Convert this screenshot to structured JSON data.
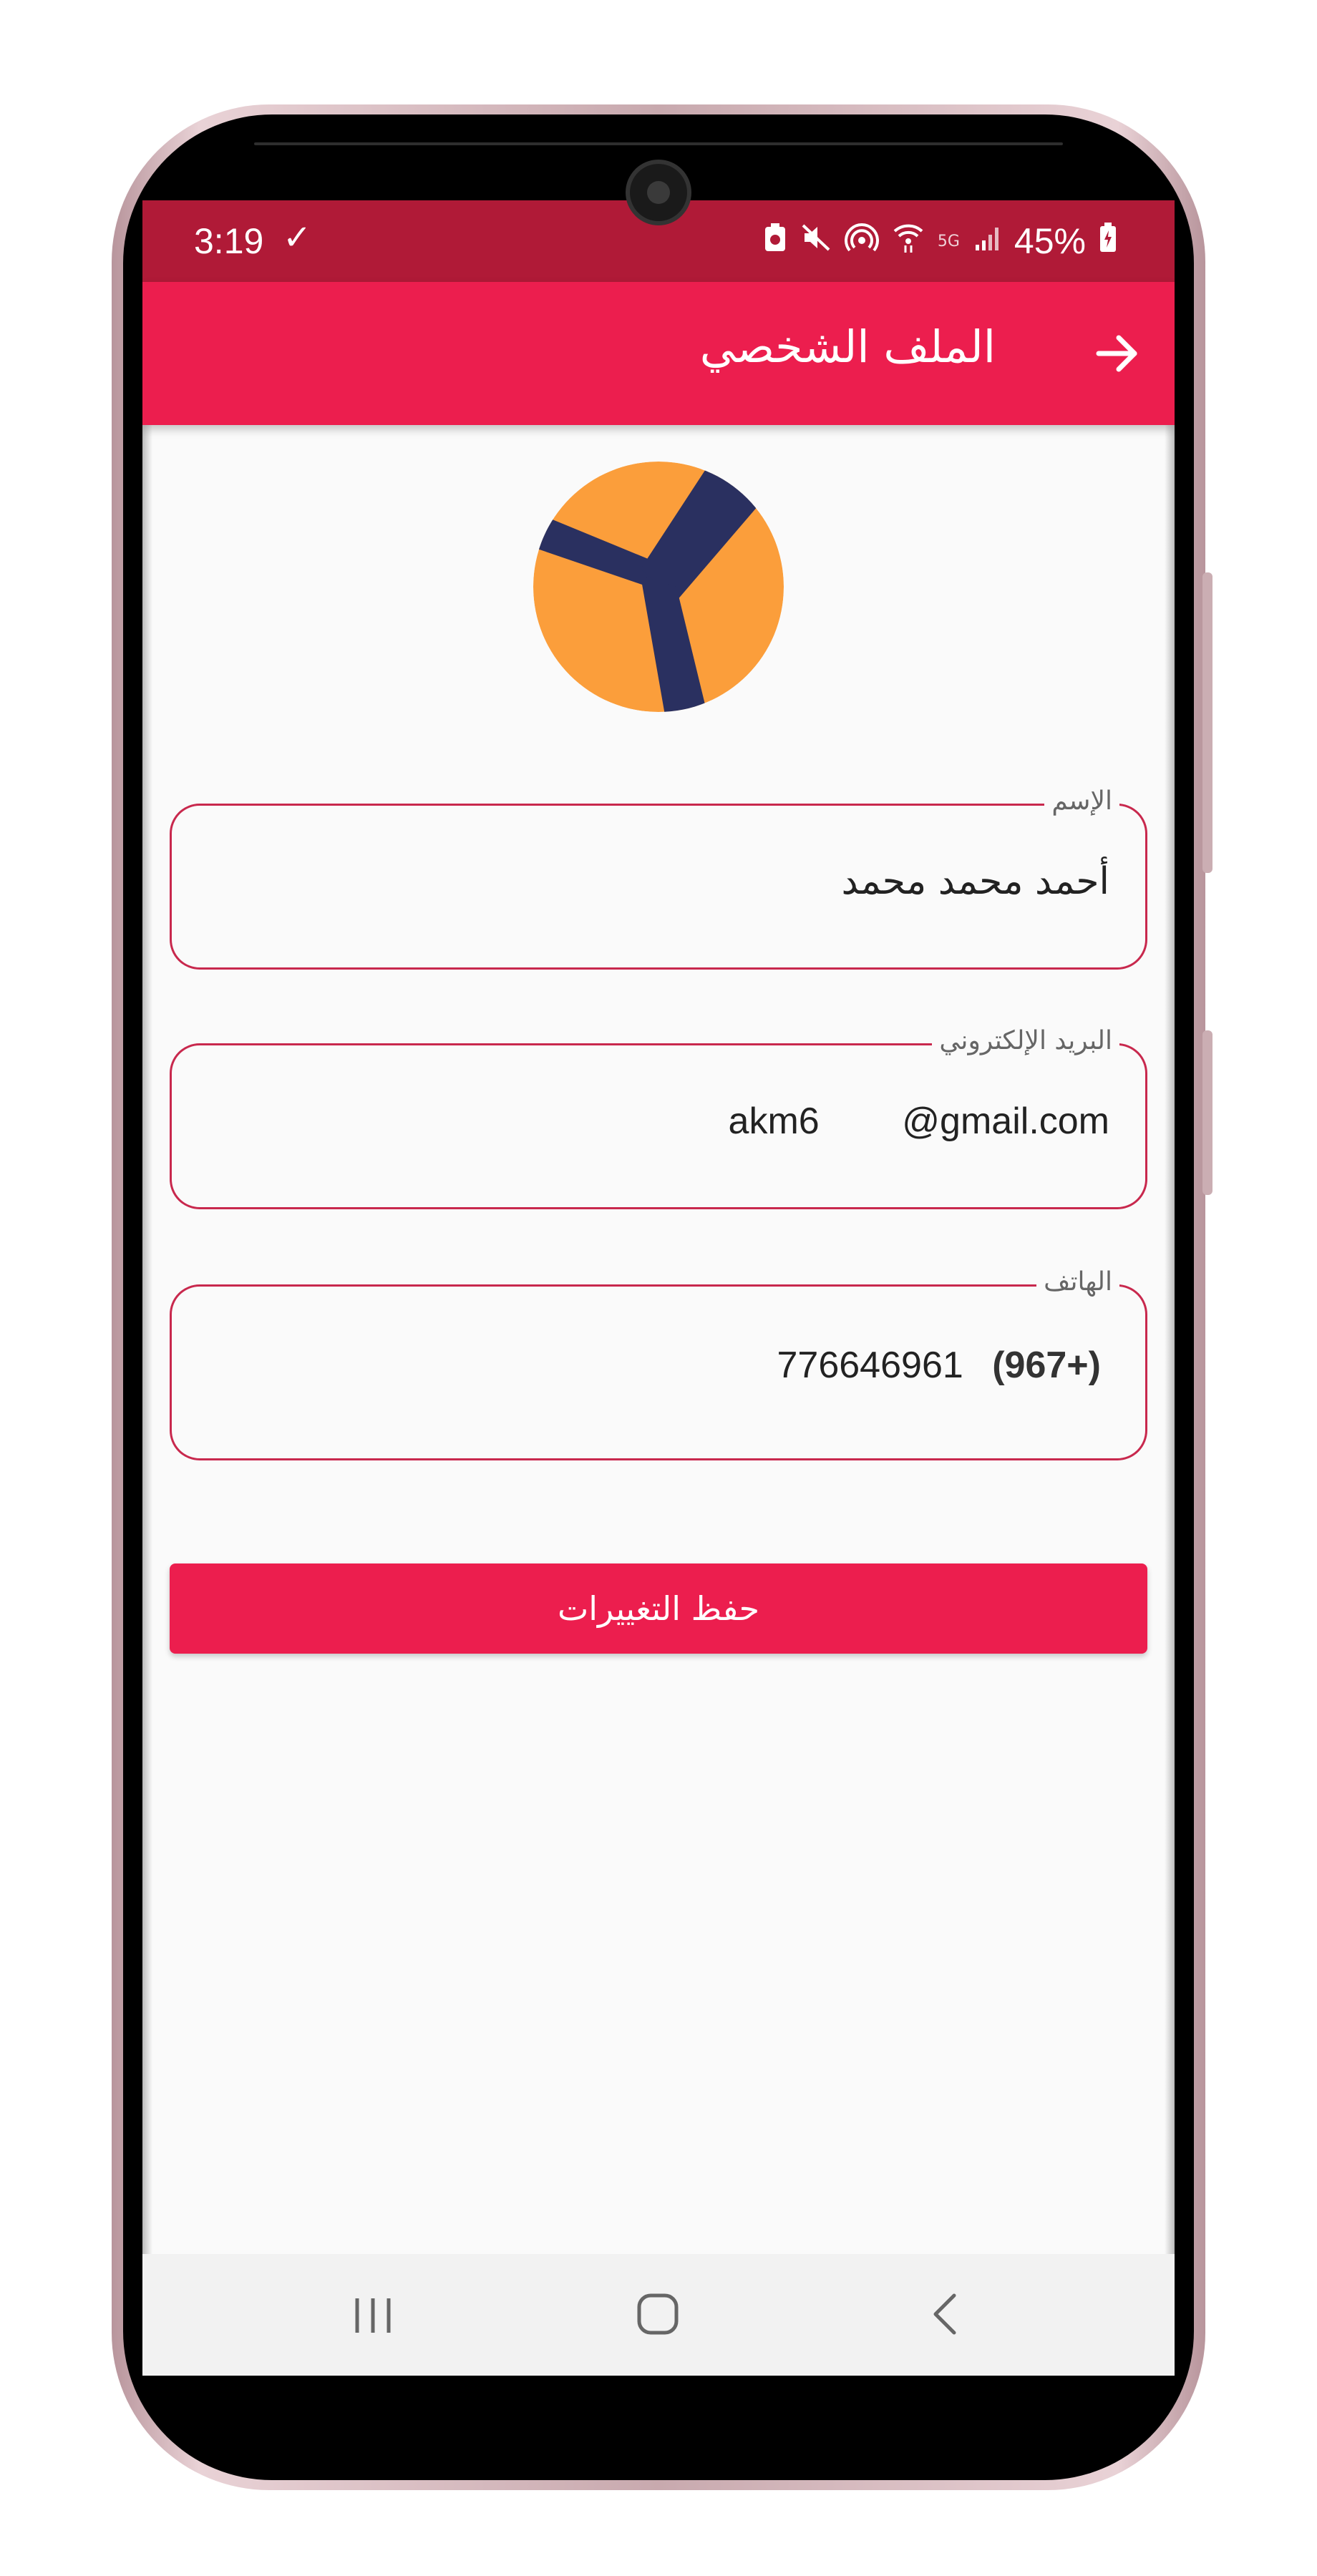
{
  "status_bar": {
    "time": "3:19",
    "battery": "45%",
    "icons": [
      "check-icon",
      "battery-saver-icon",
      "mute-icon",
      "hotspot-icon",
      "wifi-icon",
      "5g-icon",
      "signal-icon",
      "battery-charging-icon"
    ],
    "background": "#b01a37"
  },
  "app_bar": {
    "title": "الملف الشخصي",
    "back_icon": "arrow-right-icon",
    "background": "#ec1e4e"
  },
  "avatar": {
    "colors": {
      "circle": "#fb9e3b",
      "mark": "#2a3060"
    }
  },
  "form": {
    "name": {
      "label": "الإسم",
      "value": "أحمد محمد محمد"
    },
    "email": {
      "label": "البريد الإلكتروني",
      "value": "akm6        @gmail.com"
    },
    "phone": {
      "label": "الهاتف",
      "code": "(967+)",
      "number": "776646961"
    },
    "border_color": "#c8284d"
  },
  "save_button": {
    "label": "حفظ التغييرات"
  },
  "nav_bar": {
    "recents_icon": "recents-icon",
    "home_icon": "home-icon",
    "back_icon": "back-chevron-icon"
  }
}
